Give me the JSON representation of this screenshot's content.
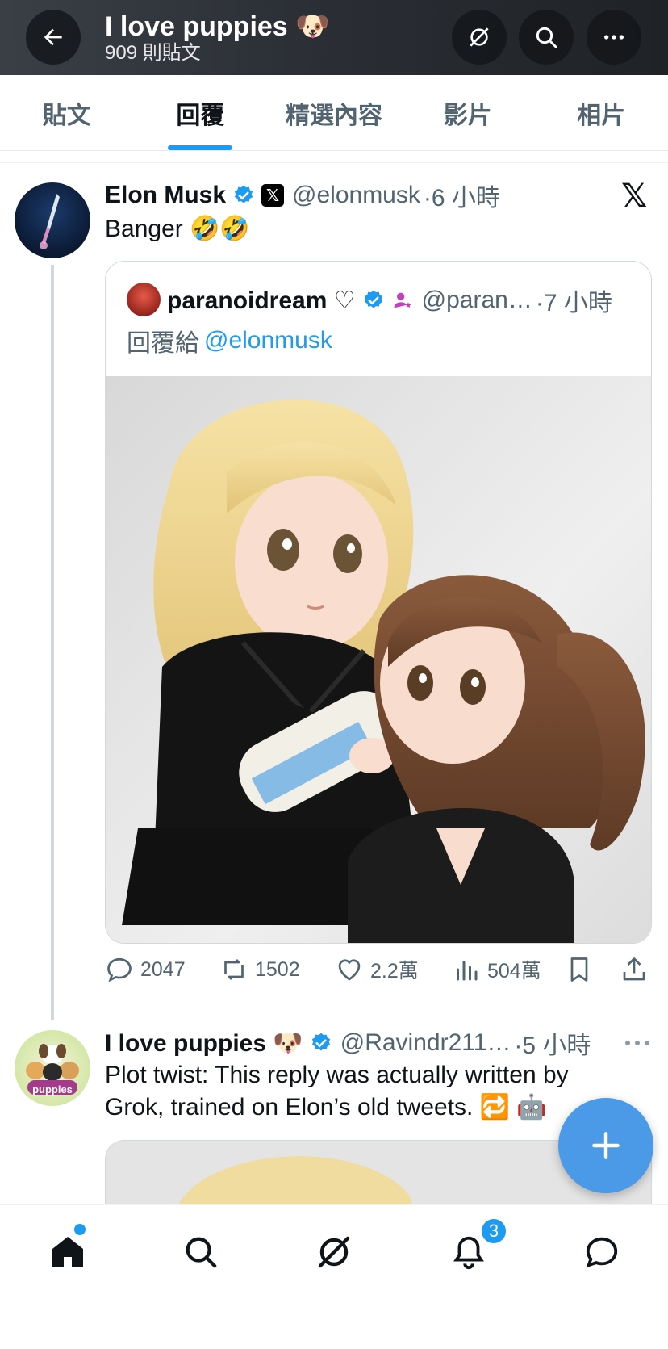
{
  "header": {
    "title": "I love puppies 🐶",
    "subtitle": "909 則貼文"
  },
  "tabs": [
    {
      "label": "貼文",
      "active": false
    },
    {
      "label": "回覆",
      "active": true
    },
    {
      "label": "精選內容",
      "active": false
    },
    {
      "label": "影片",
      "active": false
    },
    {
      "label": "相片",
      "active": false
    }
  ],
  "tweet1": {
    "name": "Elon Musk",
    "handle": "@elonmusk",
    "time": "·6 小時",
    "text": "Banger 🤣🤣",
    "quote": {
      "name": "paranoidream ♡",
      "handle": "@paran…",
      "time": "·7 小時",
      "reply_prefix": "回覆給",
      "reply_to": "@elonmusk"
    },
    "stats": {
      "replies": "2047",
      "reposts": "1502",
      "likes": "2.2萬",
      "views": "504萬"
    }
  },
  "tweet2": {
    "name": "I love puppies 🐶",
    "handle": "@Ravindr211…",
    "time": "·5 小時",
    "text_line1": "Plot twist: This reply was actually written by",
    "text_line2": "Grok, trained on Elon’s old tweets. 🔁 🤖",
    "avatar_label": "puppies"
  },
  "nav": {
    "notification_count": "3"
  },
  "colors": {
    "accent": "#1d9bf0",
    "fab": "#4a9ae8"
  }
}
